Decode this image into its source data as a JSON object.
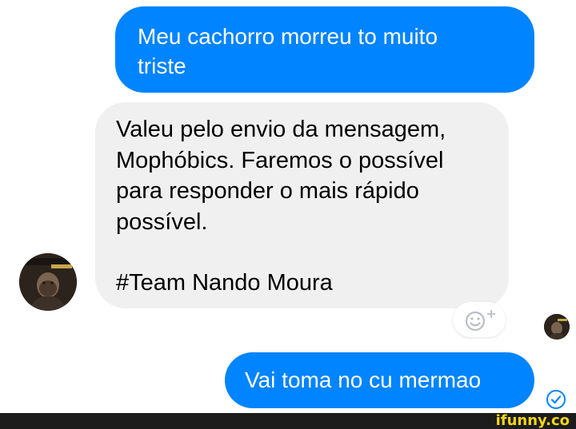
{
  "conversation": {
    "messages": [
      {
        "sender": "me",
        "text": "Meu cachorro morreu to muito triste",
        "lines": [
          "Meu cachorro morreu to muito",
          "triste"
        ]
      },
      {
        "sender": "page",
        "lines": [
          "Valeu pelo envio da mensagem,",
          "Mophóbics. Faremos o possível",
          "para responder o mais rápido",
          "possível.",
          "#Team Nando Moura"
        ]
      },
      {
        "sender": "me",
        "text": "Vai toma no cu mermao"
      }
    ],
    "reaction_button": {
      "icon": "smiley-plus-icon",
      "label": "+"
    },
    "seen_indicator": {
      "icon": "check-circle-icon"
    },
    "colors": {
      "outgoing_bubble": "#0084ff",
      "incoming_bubble": "#f1f0f0",
      "reaction_icon": "#b9bdc4"
    }
  },
  "watermark": {
    "text": "ifunny.co",
    "color": "#f7d417"
  }
}
